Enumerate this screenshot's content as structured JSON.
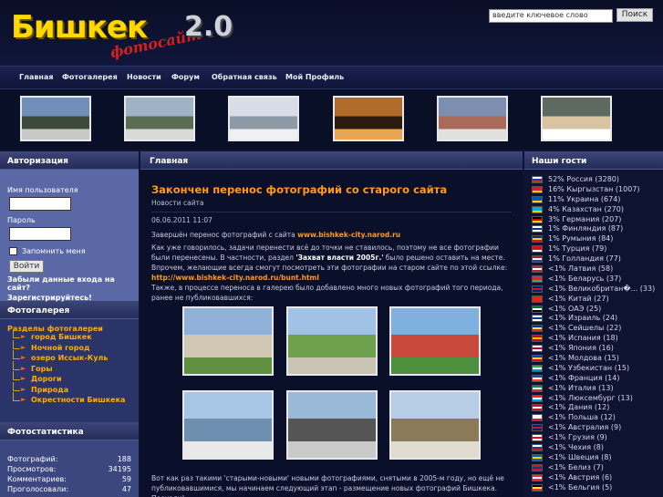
{
  "header": {
    "logo": {
      "main": "Бишкек",
      "sub": "фотосайт",
      "version": "2.0"
    },
    "search": {
      "placeholder": "введите ключевое слово",
      "button": "Поиск"
    }
  },
  "nav": [
    "Главная",
    "Фотогалерея",
    "Новости",
    "Форум",
    "Обратная связь",
    "Мой Профиль"
  ],
  "left": {
    "auth": {
      "title": "Авторизация",
      "username_label": "Имя пользователя",
      "password_label": "Пароль",
      "remember_label": "Запомнить меня",
      "login_button": "Войти",
      "forgot_link": "Забыли данные входа на сайт?",
      "register_link": "Зарегистрируйтесь!"
    },
    "gallery": {
      "title": "Фотогалерея",
      "root": "Разделы фотогалереи",
      "items": [
        "город Бишкек",
        "Ночной город",
        "озеро Иссык-Куль",
        "Горы",
        "Дороги",
        "Природа",
        "Окрестности Бишкека"
      ]
    },
    "stats": {
      "title": "Фотостатистика",
      "rows": [
        {
          "label": "Фотографий:",
          "value": "188"
        },
        {
          "label": "Просмотров:",
          "value": "34195"
        },
        {
          "label": "Комментариев:",
          "value": "59"
        },
        {
          "label": "Проголосовали:",
          "value": "47"
        }
      ]
    }
  },
  "main": {
    "title": "Главная",
    "article": {
      "headline": "Закончен перенос фотографий со старого сайта",
      "category": "Новости сайта",
      "date": "06.06.2011 11:07",
      "p1_pre": "Завершён перенос фотографий с сайта ",
      "p1_link": "www.bishkek-city.narod.ru",
      "p2_a": "Как уже говорилось, задачи перенести всё до точки не ставилось, поэтому не все фотографии были перенесены. В частности, раздел ",
      "p2_hl": "'Захват власти 2005г.'",
      "p2_b": " было решено оставить на месте. Впрочем, желающие всегда смогут посмотреть эти фотографии на старом сайте по этой ссылке:",
      "p2_link": "http://www.bishkek-city.narod.ru/bunt.html",
      "p3": "Также, в процессе переноса в галерею было добавлено много новых фотографий того периода, ранее не публиковавшихся:",
      "p4": "Вот как раз такими 'старыми-новыми' новыми фотографиями, снятыми в 2005-м году, но ещё не публиковавшимися, мы начинаем следующий этап - размещение новых фотографий Бишкека. Поехали!"
    }
  },
  "right": {
    "title": "Наши гости",
    "guests": [
      {
        "pct": "52%",
        "country": "Россия",
        "count": "(3280)",
        "flag": [
          "#ffffff",
          "#1c3fa8",
          "#d52b1e"
        ]
      },
      {
        "pct": "16%",
        "country": "Кыргызстан",
        "count": "(1007)",
        "flag": [
          "#e8112d",
          "#e8112d",
          "#ffd400"
        ]
      },
      {
        "pct": "11%",
        "country": "Украина",
        "count": "(674)",
        "flag": [
          "#0057b8",
          "#0057b8",
          "#ffd700"
        ]
      },
      {
        "pct": "4%",
        "country": "Казахстан",
        "count": "(270)",
        "flag": [
          "#00afca",
          "#00afca",
          "#fec50c"
        ]
      },
      {
        "pct": "3%",
        "country": "Германия",
        "count": "(207)",
        "flag": [
          "#000000",
          "#dd0000",
          "#ffce00"
        ]
      },
      {
        "pct": "1%",
        "country": "Финляндия",
        "count": "(87)",
        "flag": [
          "#ffffff",
          "#003580",
          "#ffffff"
        ]
      },
      {
        "pct": "1%",
        "country": "Румыния",
        "count": "(84)",
        "flag": [
          "#002b7f",
          "#fcd116",
          "#ce1126"
        ]
      },
      {
        "pct": "1%",
        "country": "Турция",
        "count": "(79)",
        "flag": [
          "#e30a17",
          "#e30a17",
          "#ffffff"
        ]
      },
      {
        "pct": "1%",
        "country": "Голландия",
        "count": "(77)",
        "flag": [
          "#ae1c28",
          "#ffffff",
          "#21468b"
        ]
      },
      {
        "pct": "<1%",
        "country": "Латвия",
        "count": "(58)",
        "flag": [
          "#9e3039",
          "#ffffff",
          "#9e3039"
        ]
      },
      {
        "pct": "<1%",
        "country": "Беларусь",
        "count": "(37)",
        "flag": [
          "#c8313e",
          "#c8313e",
          "#4aa657"
        ]
      },
      {
        "pct": "<1%",
        "country": "Великобритан�...",
        "count": "(33)",
        "flag": [
          "#012169",
          "#c8102e",
          "#012169"
        ]
      },
      {
        "pct": "<1%",
        "country": "Китай",
        "count": "(27)",
        "flag": [
          "#de2910",
          "#de2910",
          "#de2910"
        ]
      },
      {
        "pct": "<1%",
        "country": "ОАЭ",
        "count": "(25)",
        "flag": [
          "#00732f",
          "#ffffff",
          "#000000"
        ]
      },
      {
        "pct": "<1%",
        "country": "Израиль",
        "count": "(24)",
        "flag": [
          "#ffffff",
          "#0038b8",
          "#ffffff"
        ]
      },
      {
        "pct": "<1%",
        "country": "Сейшелы",
        "count": "(22)",
        "flag": [
          "#003f87",
          "#fcd856",
          "#d62828"
        ]
      },
      {
        "pct": "<1%",
        "country": "Испания",
        "count": "(18)",
        "flag": [
          "#aa151b",
          "#f1bf00",
          "#aa151b"
        ]
      },
      {
        "pct": "<1%",
        "country": "Япония",
        "count": "(16)",
        "flag": [
          "#ffffff",
          "#bc002d",
          "#ffffff"
        ]
      },
      {
        "pct": "<1%",
        "country": "Молдова",
        "count": "(15)",
        "flag": [
          "#0046ae",
          "#ffd200",
          "#cc092f"
        ]
      },
      {
        "pct": "<1%",
        "country": "Узбекистан",
        "count": "(15)",
        "flag": [
          "#1eb53a",
          "#ffffff",
          "#0099b5"
        ]
      },
      {
        "pct": "<1%",
        "country": "Франция",
        "count": "(14)",
        "flag": [
          "#0055a4",
          "#ffffff",
          "#ef4135"
        ]
      },
      {
        "pct": "<1%",
        "country": "Италия",
        "count": "(13)",
        "flag": [
          "#009246",
          "#ffffff",
          "#ce2b37"
        ]
      },
      {
        "pct": "<1%",
        "country": "Люксембург",
        "count": "(13)",
        "flag": [
          "#ed2939",
          "#ffffff",
          "#00a1de"
        ]
      },
      {
        "pct": "<1%",
        "country": "Дания",
        "count": "(12)",
        "flag": [
          "#c8102e",
          "#ffffff",
          "#c8102e"
        ]
      },
      {
        "pct": "<1%",
        "country": "Польша",
        "count": "(12)",
        "flag": [
          "#ffffff",
          "#ffffff",
          "#dc143c"
        ]
      },
      {
        "pct": "<1%",
        "country": "Австралия",
        "count": "(9)",
        "flag": [
          "#012169",
          "#c8102e",
          "#012169"
        ]
      },
      {
        "pct": "<1%",
        "country": "Грузия",
        "count": "(9)",
        "flag": [
          "#ffffff",
          "#ff0000",
          "#ffffff"
        ]
      },
      {
        "pct": "<1%",
        "country": "Чехия",
        "count": "(8)",
        "flag": [
          "#ffffff",
          "#11457e",
          "#d7141a"
        ]
      },
      {
        "pct": "<1%",
        "country": "Швеция",
        "count": "(8)",
        "flag": [
          "#006aa7",
          "#fecc00",
          "#006aa7"
        ]
      },
      {
        "pct": "<1%",
        "country": "Белиз",
        "count": "(7)",
        "flag": [
          "#ce1126",
          "#003f87",
          "#ce1126"
        ]
      },
      {
        "pct": "<1%",
        "country": "Австрия",
        "count": "(6)",
        "flag": [
          "#ed2939",
          "#ffffff",
          "#ed2939"
        ]
      },
      {
        "pct": "<1%",
        "country": "Бельгия",
        "count": "(5)",
        "flag": [
          "#000000",
          "#fae042",
          "#ed2939"
        ]
      }
    ]
  },
  "thumb_colors": [
    [
      "#6f8fb8",
      "#3b4a3a",
      "#c8c8c8"
    ],
    [
      "#9fb3c6",
      "#5a6d52",
      "#d9d9d9"
    ],
    [
      "#d7dde6",
      "#8d9aa6",
      "#eef0f3"
    ],
    [
      "#b06a2a",
      "#2a1a10",
      "#e9a552"
    ],
    [
      "#7d8fb0",
      "#a96a5a",
      "#e0e0e0"
    ],
    [
      "#5e6a60",
      "#d9c3a2",
      "#ffffff"
    ]
  ],
  "photo_colors": [
    [
      "#8fb0d8",
      "#d0c8b4",
      "#5f8f3f"
    ],
    [
      "#9fc2e6",
      "#6fa04c",
      "#c9c4b4"
    ],
    [
      "#7fb0e0",
      "#c94a3c",
      "#4c8f3c"
    ],
    [
      "#a7c6e6",
      "#6e8fb0",
      "#e9e9e9"
    ],
    [
      "#9ab8d8",
      "#555555",
      "#c9c9c9"
    ],
    [
      "#b7cde6",
      "#8a7a5a",
      "#e0dccf"
    ]
  ]
}
